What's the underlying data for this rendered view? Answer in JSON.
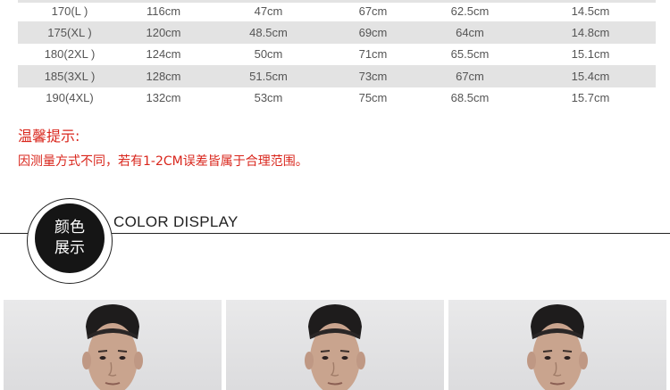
{
  "size_table": {
    "rows": [
      [
        "170(L )",
        "116cm",
        "47cm",
        "67cm",
        "62.5cm",
        "14.5cm"
      ],
      [
        "175(XL )",
        "120cm",
        "48.5cm",
        "69cm",
        "64cm",
        "14.8cm"
      ],
      [
        "180(2XL )",
        "124cm",
        "50cm",
        "71cm",
        "65.5cm",
        "15.1cm"
      ],
      [
        "185(3XL )",
        "128cm",
        "51.5cm",
        "73cm",
        "67cm",
        "15.4cm"
      ],
      [
        "190(4XL)",
        "132cm",
        "53cm",
        "75cm",
        "68.5cm",
        "15.7cm"
      ]
    ]
  },
  "tips": {
    "title": "温馨提示:",
    "text": "因测量方式不同，若有1-2CM误差皆属于合理范围。"
  },
  "color_section": {
    "badge_line1": "颜色",
    "badge_line2": "展示",
    "title": "COLOR DISPLAY"
  },
  "colors": {
    "tip_red": "#d9261c",
    "row_shade": "#e3e3e3",
    "badge_black": "#151515"
  }
}
